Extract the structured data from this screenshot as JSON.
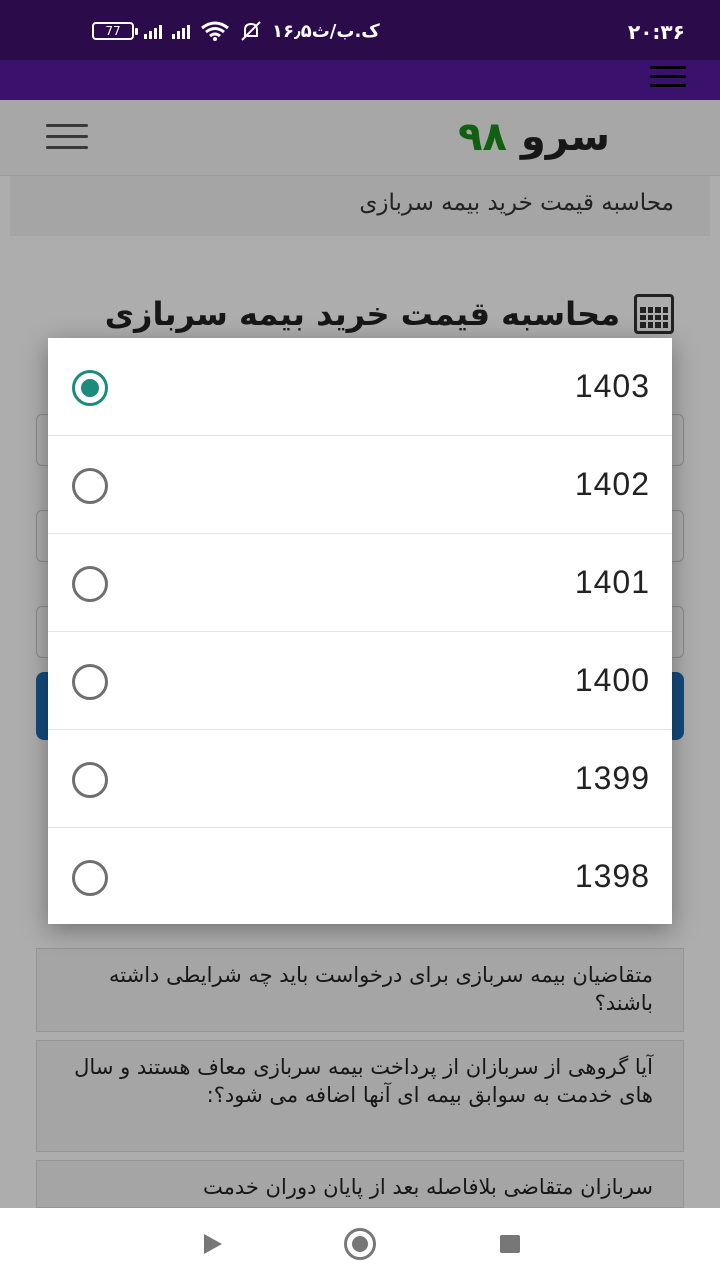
{
  "status_bar": {
    "time": "۲۰:۳۶",
    "network_speed": "۱۶٫۵ک.ب/ث",
    "battery_level": "77",
    "icons": [
      "battery-icon",
      "signal-icon",
      "signal-icon",
      "wifi-icon",
      "mute-icon"
    ]
  },
  "header": {
    "logo_word": "سرو",
    "logo_number": "۹۸",
    "logo_number_color": "#1a8c1a"
  },
  "breadcrumb": {
    "text": "محاسبه قیمت خرید بیمه سربازی"
  },
  "main": {
    "page_title": "محاسبه قیمت خرید بیمه سربازی"
  },
  "faq": {
    "items": [
      "متقاضیان بیمه سربازی برای درخواست باید چه شرایطی داشته باشند؟",
      "آیا گروهی از سربازان از پرداخت بیمه سربازی معاف هستند و سال های خدمت به سوابق بیمه ای آنها اضافه می شود؟:",
      "سربازان متقاضی بلافاصله بعد از پایان دوران خدمت"
    ]
  },
  "dialog": {
    "selected_index": 0,
    "accent_color": "#1a8c7c",
    "options": [
      {
        "label": "1403",
        "selected": true
      },
      {
        "label": "1402",
        "selected": false
      },
      {
        "label": "1401",
        "selected": false
      },
      {
        "label": "1400",
        "selected": false
      },
      {
        "label": "1399",
        "selected": false
      },
      {
        "label": "1398",
        "selected": false
      }
    ]
  },
  "nav_bar": {
    "icons": [
      "back-icon",
      "home-icon",
      "recents-icon"
    ]
  }
}
